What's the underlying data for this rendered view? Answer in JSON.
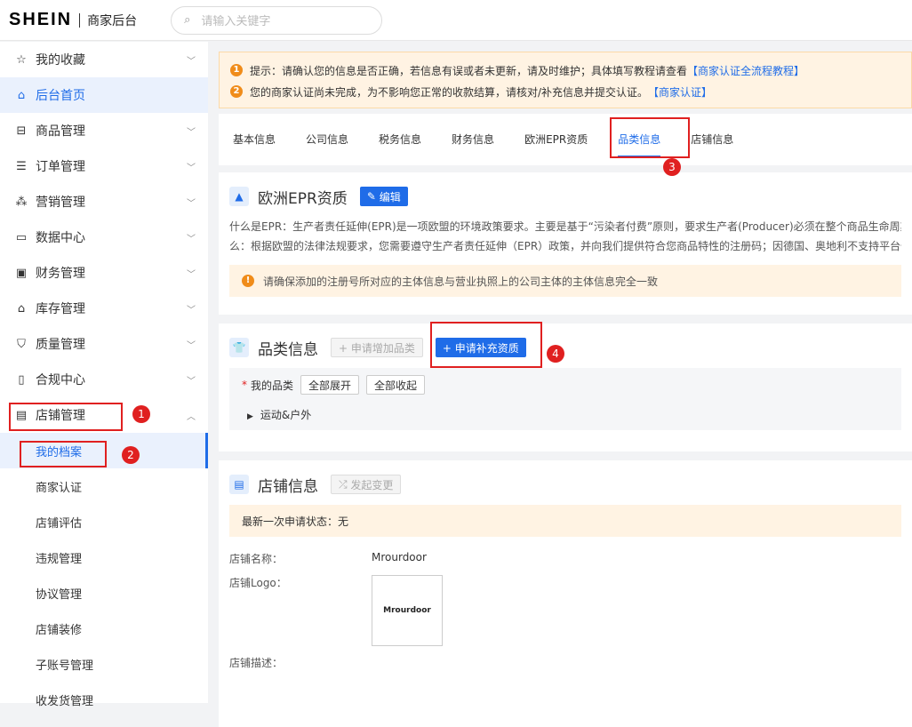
{
  "header": {
    "logo": "SHEIN",
    "subtitle": "商家后台",
    "search_placeholder": "请输入关键字"
  },
  "sidebar": {
    "items": [
      {
        "label": "我的收藏",
        "icon": "star-icon",
        "chev": "﹀"
      },
      {
        "label": "后台首页",
        "icon": "home-icon",
        "chev": ""
      },
      {
        "label": "商品管理",
        "icon": "bag-icon",
        "chev": "﹀"
      },
      {
        "label": "订单管理",
        "icon": "list-icon",
        "chev": "﹀"
      },
      {
        "label": "营销管理",
        "icon": "shapes-icon",
        "chev": "﹀"
      },
      {
        "label": "数据中心",
        "icon": "monitor-icon",
        "chev": "﹀"
      },
      {
        "label": "财务管理",
        "icon": "wallet-icon",
        "chev": "﹀"
      },
      {
        "label": "库存管理",
        "icon": "warehouse-icon",
        "chev": "﹀"
      },
      {
        "label": "质量管理",
        "icon": "shield-icon",
        "chev": "﹀"
      },
      {
        "label": "合规中心",
        "icon": "book-icon",
        "chev": "﹀"
      },
      {
        "label": "店铺管理",
        "icon": "store-icon",
        "chev": "︿"
      }
    ],
    "sub": [
      "我的档案",
      "商家认证",
      "店铺评估",
      "违规管理",
      "协议管理",
      "店铺装修",
      "子账号管理",
      "收发货管理"
    ]
  },
  "annotations": [
    "1",
    "2",
    "3",
    "4"
  ],
  "notice": {
    "line1": "提示：请确认您的信息是否正确，若信息有误或者未更新，请及时维护；具体填写教程请查看",
    "link1": "【商家认证全流程教程】",
    "line2": "您的商家认证尚未完成，为不影响您正常的收款结算，请核对/补充信息并提交认证。",
    "link2": "【商家认证】"
  },
  "tabs": [
    "基本信息",
    "公司信息",
    "税务信息",
    "财务信息",
    "欧洲EPR资质",
    "品类信息",
    "店铺信息"
  ],
  "epr": {
    "title": "欧洲EPR资质",
    "edit": "编辑",
    "para1": "什么是EPR：生产者责任延伸(EPR)是一项欧盟的环境政策要求。主要是基于“污染者付费”原则，要求生产者(Producer)必须在整个商品生命周期",
    "para2": "么：根据欧盟的法律法规要求，您需要遵守生产者责任延伸（EPR）政策，并向我们提供符合您商品特性的注册码；因德国、奥地利不支持平台代扣",
    "warning": "请确保添加的注册号所对应的主体信息与营业执照上的公司主体的主体信息完全一致"
  },
  "category": {
    "title": "品类信息",
    "add_btn": "+ 申请增加品类",
    "supp_btn": "+ 申请补充资质",
    "my_label": "我的品类",
    "expand": "全部展开",
    "collapse": "全部收起",
    "item": "运动&户外"
  },
  "store": {
    "title": "店铺信息",
    "change_btn": "发起变更",
    "status": "最新一次申请状态：无",
    "name_label": "店铺名称：",
    "name_value": "Mrourdoor",
    "logo_label": "店铺Logo：",
    "logo_text": "Mrourdoor",
    "desc_label": "店铺描述："
  }
}
